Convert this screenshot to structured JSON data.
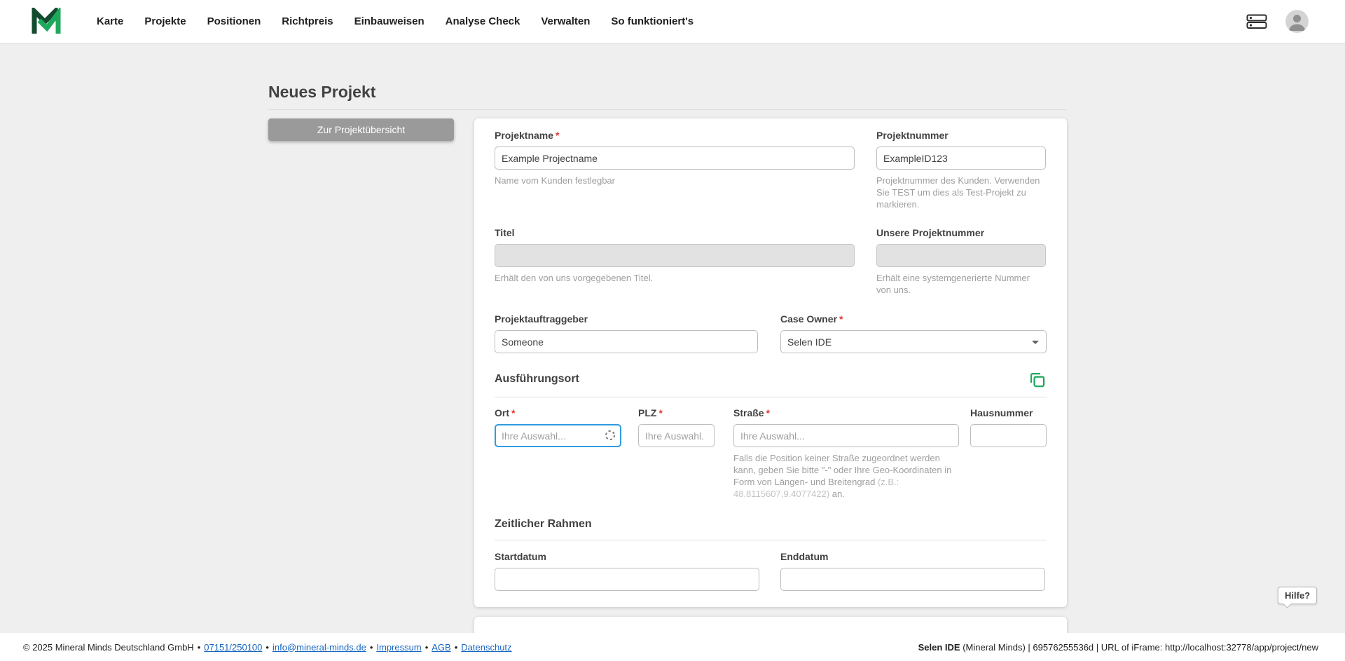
{
  "nav": {
    "items": [
      "Karte",
      "Projekte",
      "Positionen",
      "Richtpreis",
      "Einbauweisen",
      "Analyse Check",
      "Verwalten",
      "So funktioniert's"
    ]
  },
  "page": {
    "title": "Neues Projekt",
    "back_button": "Zur Projektübersicht"
  },
  "form": {
    "projektname": {
      "label": "Projektname",
      "required": "*",
      "value": "Example Projectname",
      "helper": "Name vom Kunden festlegbar"
    },
    "projektnummer": {
      "label": "Projektnummer",
      "value": "ExampleID123",
      "helper": "Projektnummer des Kunden. Verwenden Sie TEST um dies als Test-Projekt zu markieren."
    },
    "titel": {
      "label": "Titel",
      "value": "",
      "helper": "Erhält den von uns vorgegebenen Titel."
    },
    "unsere_projektnummer": {
      "label": "Unsere Projektnummer",
      "value": "",
      "helper": "Erhält eine systemgenerierte Nummer von uns."
    },
    "projektauftraggeber": {
      "label": "Projektauftraggeber",
      "value": "Someone"
    },
    "case_owner": {
      "label": "Case Owner",
      "required": "*",
      "value": "Selen IDE"
    },
    "section_ausfuehrungsort": "Ausführungsort",
    "ort": {
      "label": "Ort",
      "required": "*",
      "placeholder": "Ihre Auswahl..."
    },
    "plz": {
      "label": "PLZ",
      "required": "*",
      "placeholder": "Ihre Auswahl."
    },
    "strasse": {
      "label": "Straße",
      "required": "*",
      "placeholder": "Ihre Auswahl...",
      "helper_main": "Falls die Position keiner Straße zugeordnet werden kann, geben Sie bitte \"-\" oder Ihre Geo-Koordinaten in Form von Längen- und Breitengrad ",
      "helper_example": "(z.B.: 48.8115607,9.4077422)",
      "helper_suffix": " an."
    },
    "hausnummer": {
      "label": "Hausnummer",
      "value": ""
    },
    "section_zeitlicher_rahmen": "Zeitlicher Rahmen",
    "startdatum": {
      "label": "Startdatum",
      "value": ""
    },
    "enddatum": {
      "label": "Enddatum",
      "value": ""
    }
  },
  "help": {
    "label": "Hilfe?"
  },
  "footer": {
    "copyright": "© 2025 Mineral Minds Deutschland GmbH",
    "sep": "•",
    "phone": "07151/250100",
    "email": "info@mineral-minds.de",
    "impressum": "Impressum",
    "agb": "AGB",
    "datenschutz": "Datenschutz",
    "user": "Selen IDE",
    "session": " (Mineral Minds) | 69576255536d | URL of iFrame: http://localhost:32778/app/project/new"
  },
  "icons": {
    "logo": "mineral-minds-logo",
    "header_right": [
      "server-icon",
      "user-avatar"
    ],
    "ausfuehrungsort_action": "copy-icon",
    "ort_loading": "loading-spinner-icon",
    "case_owner_dropdown": "chevron-down-icon"
  },
  "colors": {
    "brand_green": "#1da85c",
    "brand_green_dark": "#134b2e",
    "focus_blue": "#2f9bdf",
    "link_blue": "#1565c0",
    "required_red": "#e53935",
    "button_gray": "#9a9a9a"
  }
}
